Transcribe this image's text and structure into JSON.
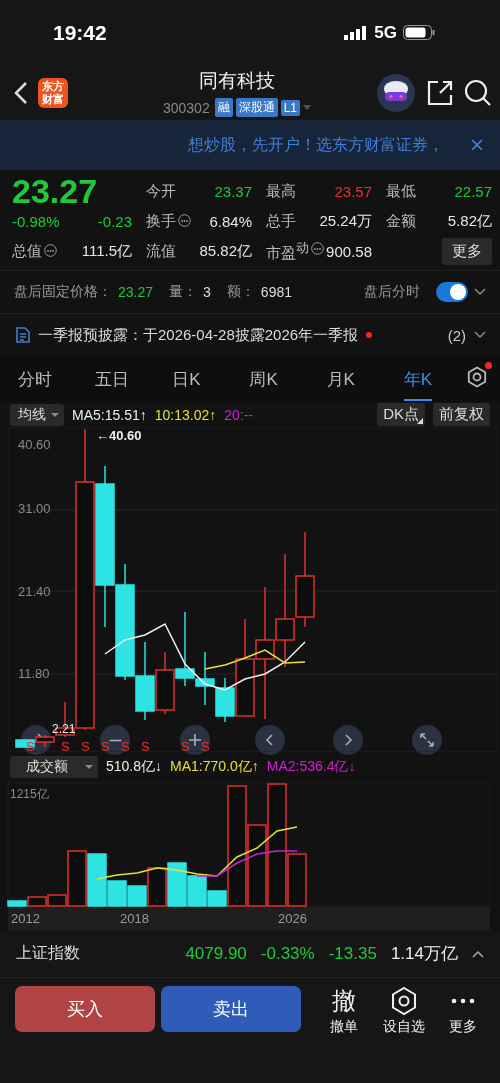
{
  "status_bar": {
    "time": "19:42",
    "network": "5G"
  },
  "header": {
    "logo_text": "东方财富",
    "title": "同有科技",
    "code": "300302",
    "badges": [
      "融",
      "深股通",
      "L1"
    ]
  },
  "banner": {
    "text": "想炒股，先开户！选东方财富证券，",
    "close": "×"
  },
  "quote": {
    "price": "23.27",
    "change_pct": "-0.98%",
    "change": "-0.23",
    "color": "#22c83a",
    "fields": [
      {
        "label": "今开",
        "value": "23.37",
        "color": "#22c83a",
        "info": false
      },
      {
        "label": "最高",
        "value": "23.57",
        "color": "#e8302f",
        "info": false
      },
      {
        "label": "最低",
        "value": "22.57",
        "color": "#22c83a",
        "info": false
      },
      {
        "label": "换手",
        "value": "6.84%",
        "color": "#e6e6e6",
        "info": true
      },
      {
        "label": "总手",
        "value": "25.24万",
        "color": "#e6e6e6",
        "info": false
      },
      {
        "label": "金额",
        "value": "5.82亿",
        "color": "#e6e6e6",
        "info": false
      },
      {
        "label": "总值",
        "value": "111.5亿",
        "color": "#e6e6e6",
        "info": true
      },
      {
        "label": "流值",
        "value": "85.82亿",
        "color": "#e6e6e6",
        "info": false
      },
      {
        "label": "市盈$^{动}$",
        "value": "900.58",
        "color": "#e6e6e6",
        "info": true
      }
    ],
    "more": "更多"
  },
  "after_hours": {
    "label": "盘后固定价格：",
    "price": "23.27",
    "volume_label": "量：",
    "volume": "3",
    "amount_label": "额：",
    "amount": "6981",
    "toggle_label": "盘后分时",
    "on": true
  },
  "notice": {
    "text": "一季报预披露：于2026-04-28披露2026年一季报",
    "unread": true,
    "count": "(2)"
  },
  "tabs": [
    {
      "label": "分时",
      "selected": false
    },
    {
      "label": "五日",
      "selected": false
    },
    {
      "label": "日K",
      "selected": false
    },
    {
      "label": "周K",
      "selected": false
    },
    {
      "label": "月K",
      "selected": false
    },
    {
      "label": "年K",
      "selected": true
    }
  ],
  "settings_badge": true,
  "kline": {
    "indicator": "均线",
    "ma": [
      {
        "text": "MA5:15.51↑",
        "color": "#f0f0f0"
      },
      {
        "text": "10:13.02↑",
        "color": "#e6e03c"
      },
      {
        "text": "20:--",
        "color": "#d21ed2"
      }
    ],
    "dk": "DK点",
    "adjust": "前复权",
    "yticks": [
      "40.60",
      "31.00",
      "21.40",
      "11.80"
    ],
    "high_label": "←40.60",
    "low_label": "2.21",
    "signals": [
      "S",
      "S",
      "S",
      "S",
      "S",
      "S",
      "S",
      "S"
    ]
  },
  "volume": {
    "indicator": "成交额",
    "values": [
      {
        "text": "510.8亿↓",
        "color": "#f0f0f0"
      },
      {
        "text": "MA1:770.0亿↑",
        "color": "#e6e03c"
      },
      {
        "text": "MA2:536.4亿↓",
        "color": "#d21ed2"
      }
    ],
    "max_label": "1215亿",
    "xlabels": [
      "2012",
      "2018",
      "2026"
    ]
  },
  "index_bar": {
    "name": "上证指数",
    "value": "4079.90",
    "pct": "-0.33%",
    "change": "-13.35",
    "turnover": "1.14万亿",
    "color": "#22c83a"
  },
  "actions": {
    "buy": "买入",
    "sell": "卖出",
    "tools": [
      {
        "kind": "glyph",
        "glyph": "撤",
        "label": "撤单"
      },
      {
        "kind": "hexagon",
        "label": "设自选"
      },
      {
        "kind": "dots",
        "label": "更多"
      }
    ]
  }
}
